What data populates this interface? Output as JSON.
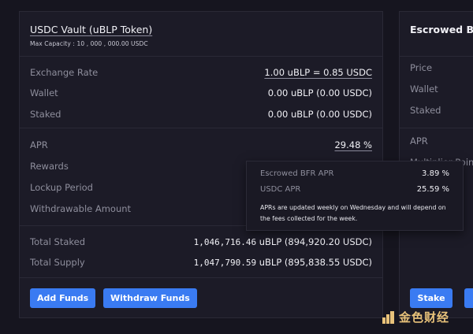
{
  "vault": {
    "title": "USDC Vault (uBLP Token)",
    "max_capacity": "Max Capacity : 10 , 000 , 000.00 USDC",
    "rows_top": [
      {
        "label": "Exchange Rate",
        "value": "1.00 uBLP = 0.85 USDC"
      },
      {
        "label": "Wallet",
        "value": "0.00 uBLP (0.00 USDC)"
      },
      {
        "label": "Staked",
        "value": "0.00 uBLP (0.00 USDC)"
      }
    ],
    "rows_mid": [
      {
        "label": "APR",
        "value": "29.48 %"
      },
      {
        "label": "Rewards",
        "value": ""
      },
      {
        "label": "Lockup Period",
        "value": ""
      },
      {
        "label": "Withdrawable Amount",
        "value": ""
      }
    ],
    "rows_bottom": [
      {
        "label": "Total Staked",
        "value_num": "1,046,716.46",
        "value_rest": " uBLP (894,920.20 USDC)"
      },
      {
        "label": "Total Supply",
        "value_num": "1,047,790.59",
        "value_rest": " uBLP (895,838.55 USDC)"
      }
    ],
    "add_funds_label": "Add Funds",
    "withdraw_funds_label": "Withdraw Funds"
  },
  "escrow": {
    "title": "Escrowed BFR",
    "labels": [
      "Price",
      "Wallet",
      "Staked",
      "APR",
      "Multiplier Point"
    ],
    "stake_label": "Stake"
  },
  "tooltip": {
    "rows": [
      {
        "key": "Escrowed BFR APR",
        "value": "3.89 %"
      },
      {
        "key": "USDC APR",
        "value": "25.59 %"
      }
    ],
    "note": "APRs are updated weekly on Wednesday and will depend on the fees collected for the week."
  },
  "watermark": {
    "text": "金色财经"
  },
  "colors": {
    "accent": "#3a7bf2",
    "background": "#16151f",
    "card": "#1c1b27",
    "watermark": "#e8c27a"
  }
}
